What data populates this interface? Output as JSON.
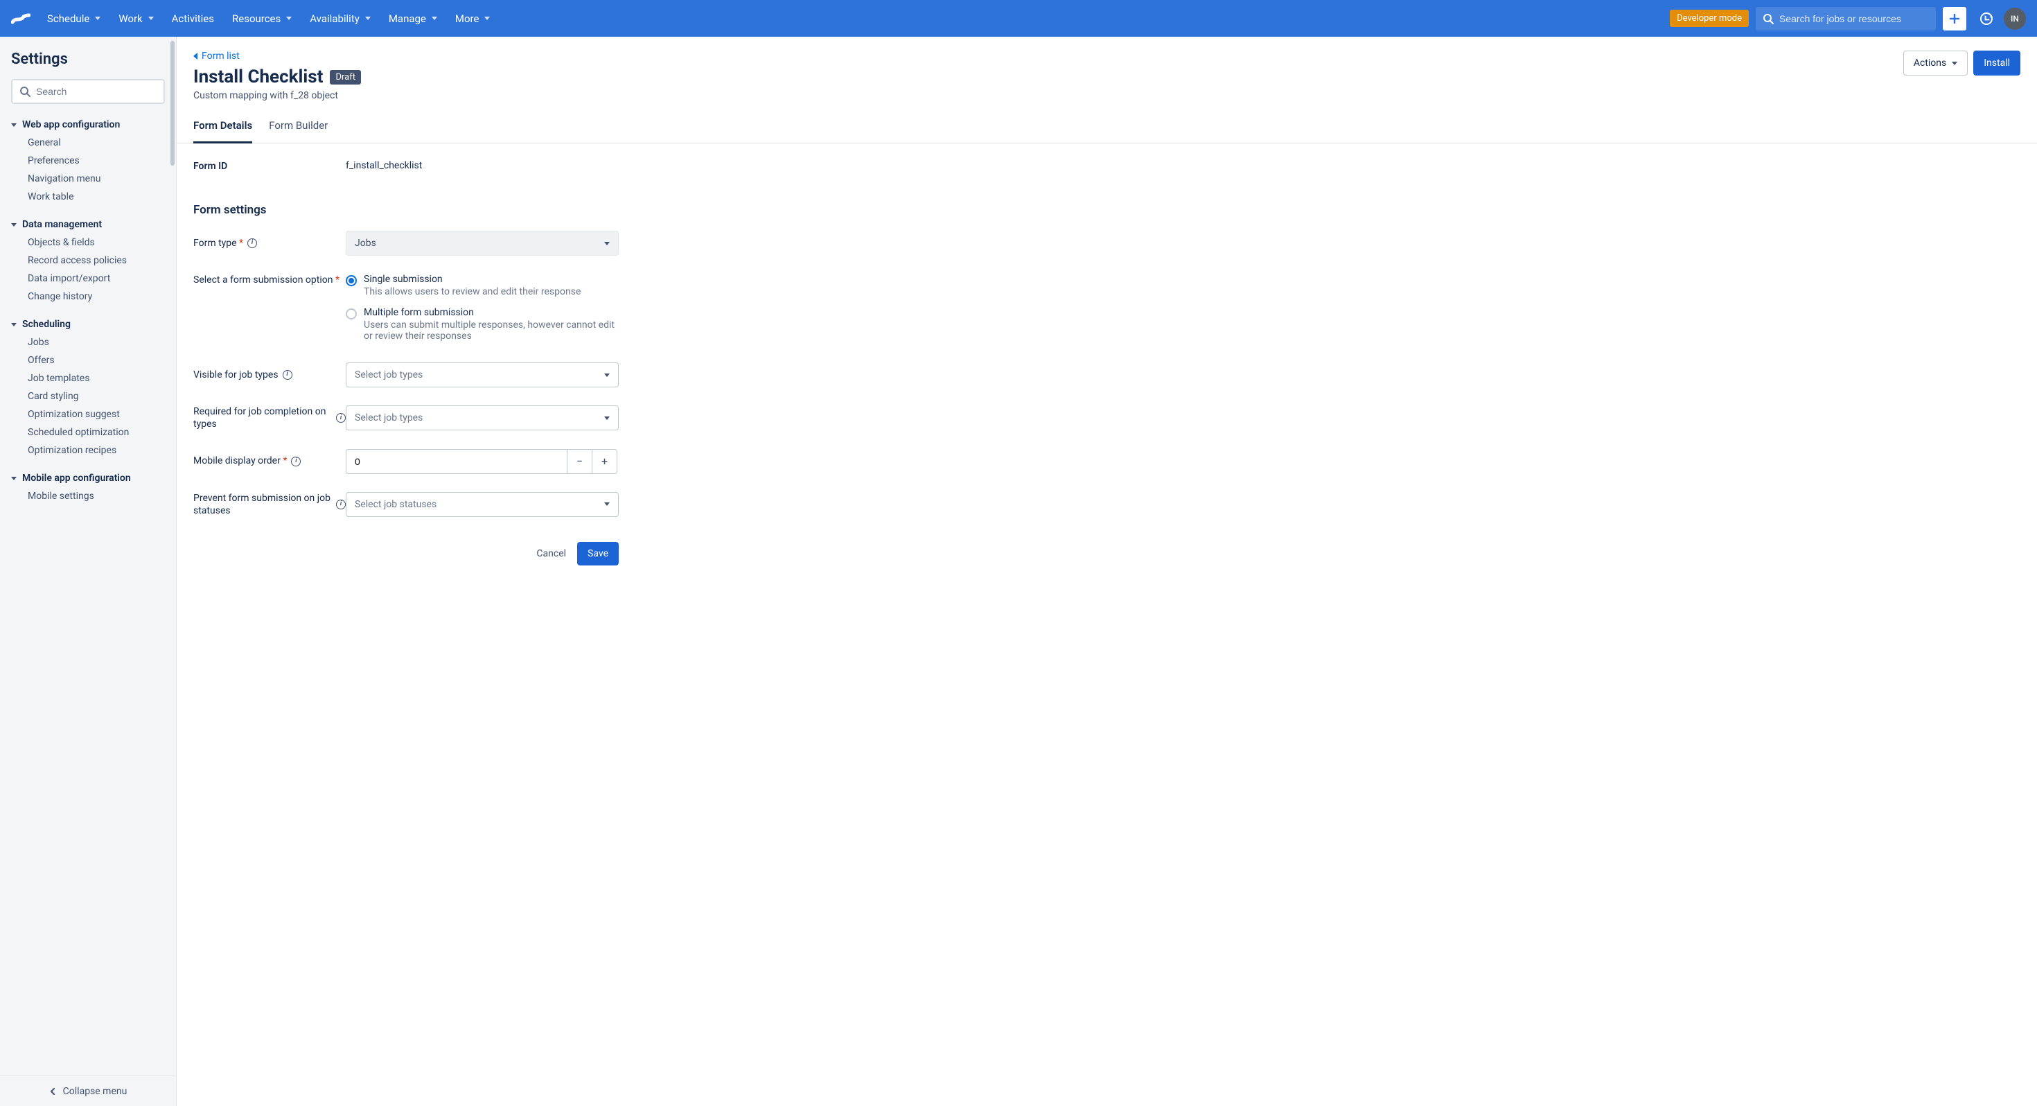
{
  "nav": {
    "items": [
      "Schedule",
      "Work",
      "Activities",
      "Resources",
      "Availability",
      "Manage",
      "More"
    ],
    "no_caret": [
      "Activities"
    ],
    "dev_mode": "Developer mode",
    "search_placeholder": "Search for jobs or resources",
    "avatar": "IN"
  },
  "sidebar": {
    "title": "Settings",
    "search_placeholder": "Search",
    "sections": [
      {
        "title": "Web app configuration",
        "items": [
          "General",
          "Preferences",
          "Navigation menu",
          "Work table"
        ]
      },
      {
        "title": "Data management",
        "items": [
          "Objects & fields",
          "Record access policies",
          "Data import/export",
          "Change history"
        ]
      },
      {
        "title": "Scheduling",
        "items": [
          "Jobs",
          "Offers",
          "Job templates",
          "Card styling",
          "Optimization suggest",
          "Scheduled optimization",
          "Optimization recipes"
        ]
      },
      {
        "title": "Mobile app configuration",
        "items": [
          "Mobile settings"
        ]
      }
    ],
    "collapse": "Collapse menu"
  },
  "page": {
    "breadcrumb": "Form list",
    "title": "Install Checklist",
    "badge": "Draft",
    "subtitle": "Custom mapping with f_28 object",
    "actions_btn": "Actions",
    "install_btn": "Install",
    "tabs": [
      "Form Details",
      "Form Builder"
    ],
    "active_tab": "Form Details"
  },
  "form": {
    "form_id_label": "Form ID",
    "form_id_value": "f_install_checklist",
    "section_title": "Form settings",
    "rows": {
      "form_type": {
        "label": "Form type",
        "value": "Jobs"
      },
      "submission": {
        "label": "Select a form submission option",
        "options": [
          {
            "title": "Single submission",
            "desc": "This allows users to review and edit their response",
            "checked": true
          },
          {
            "title": "Multiple form submission",
            "desc": "Users can submit multiple responses, however cannot edit or review their responses",
            "checked": false
          }
        ]
      },
      "visible_types": {
        "label": "Visible for job types",
        "placeholder": "Select job types"
      },
      "required_types": {
        "label": "Required for job completion on types",
        "placeholder": "Select job types"
      },
      "display_order": {
        "label": "Mobile display order",
        "value": "0"
      },
      "prevent_statuses": {
        "label": "Prevent form submission on job statuses",
        "placeholder": "Select job statuses"
      }
    },
    "footer": {
      "cancel": "Cancel",
      "save": "Save"
    }
  }
}
